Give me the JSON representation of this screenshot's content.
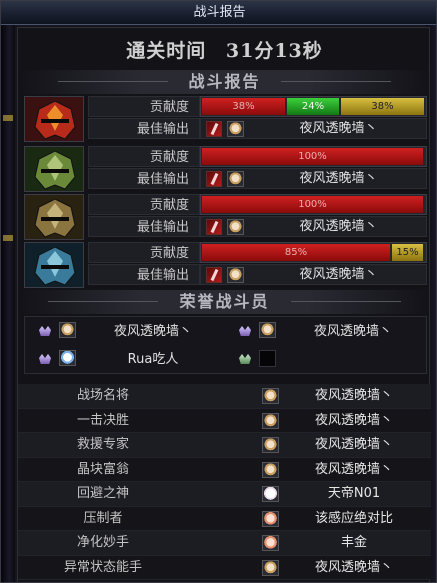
{
  "window": {
    "title": "战斗报告"
  },
  "summary": {
    "clear_label": "通关时间",
    "clear_time": "31分13秒"
  },
  "sections": {
    "battle_report": "战斗报告",
    "honor": "荣誉战斗员"
  },
  "labels": {
    "contribution": "贡献度",
    "best_output": "最佳输出"
  },
  "players": [
    {
      "portrait": "red-helmet-icon",
      "contribution": [
        {
          "text": "38%",
          "value": 38,
          "color": "red"
        },
        {
          "text": "24%",
          "value": 24,
          "color": "green"
        },
        {
          "text": "38%",
          "value": 38,
          "color": "gold"
        }
      ],
      "best_output_name": "夜风透晚墙丶"
    },
    {
      "portrait": "green-helmet-icon",
      "contribution": [
        {
          "text": "100%",
          "value": 100,
          "color": "red"
        }
      ],
      "best_output_name": "夜风透晚墙丶"
    },
    {
      "portrait": "gold-helmet-icon",
      "contribution": [
        {
          "text": "100%",
          "value": 100,
          "color": "red"
        }
      ],
      "best_output_name": "夜风透晚墙丶"
    },
    {
      "portrait": "blue-helmet-icon",
      "contribution": [
        {
          "text": "85%",
          "value": 85,
          "color": "red"
        },
        {
          "text": "15%",
          "value": 15,
          "color": "gold"
        }
      ],
      "best_output_name": "夜风透晚墙丶"
    }
  ],
  "honor_members": [
    {
      "name": "夜风透晚墙丶",
      "has_avatar": true
    },
    {
      "name": "夜风透晚墙丶",
      "has_avatar": true
    },
    {
      "name": "Rua吃人",
      "has_avatar": true
    },
    {
      "name": "",
      "has_avatar": false
    }
  ],
  "awards": [
    {
      "title": "战场名将",
      "player": "夜风透晚墙丶"
    },
    {
      "title": "一击决胜",
      "player": "夜风透晚墙丶"
    },
    {
      "title": "救援专家",
      "player": "夜风透晚墙丶"
    },
    {
      "title": "晶块富翁",
      "player": "夜风透晚墙丶"
    },
    {
      "title": "回避之神",
      "player": "天帝N01"
    },
    {
      "title": "压制者",
      "player": "该感应绝对比"
    },
    {
      "title": "净化妙手",
      "player": "丰金"
    },
    {
      "title": "异常状态能手",
      "player": "夜风透晚墙丶"
    }
  ],
  "colors": {
    "red": "#b81a1a",
    "green": "#2ea82e",
    "gold": "#c8a828",
    "panel": "#121217"
  }
}
